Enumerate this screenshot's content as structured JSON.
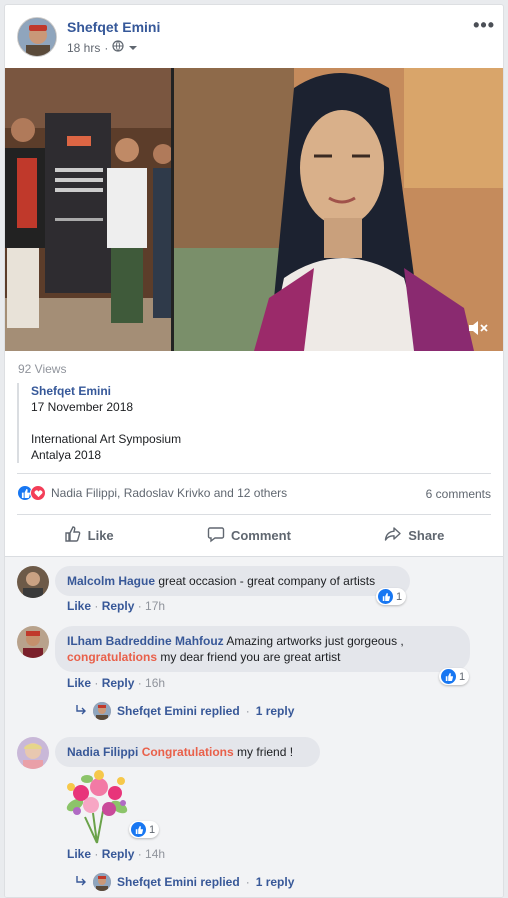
{
  "post": {
    "author": "Shefqet Emini",
    "time": "18 hrs",
    "privacy_icon": "globe-icon",
    "more_icon": "more-dots-icon",
    "views": "92 Views"
  },
  "quote": {
    "name": "Shefqet Emini",
    "date": "17 November 2018",
    "line1": "International Art Symposium",
    "line2": "Antalya 2018"
  },
  "reactions": {
    "summary": "Nadia Filippi, Radoslav Krivko and 12 others",
    "comments": "6 comments"
  },
  "actions": {
    "like": "Like",
    "comment": "Comment",
    "share": "Share"
  },
  "comments": [
    {
      "name": "Malcolm Hague",
      "text": "great occasion - great company of artists",
      "like": "Like",
      "reply": "Reply",
      "time": "17h",
      "reactions": "1"
    },
    {
      "name": "ILham Badreddine Mahfouz",
      "text_a": "Amazing artworks just gorgeous ,",
      "highlight": "congratulations",
      "text_b": "my dear friend you are great artist",
      "like": "Like",
      "reply": "Reply",
      "time": "16h",
      "reactions": "1",
      "replies_by": "Shefqet Emini replied",
      "replies_count": "1 reply"
    },
    {
      "name": "Nadia Filippi",
      "highlight": "Congratulations",
      "text": "my friend !",
      "like": "Like",
      "reply": "Reply",
      "time": "14h",
      "sticker_reactions": "1",
      "replies_by": "Shefqet Emini replied",
      "replies_count": "1 reply"
    }
  ],
  "colors": {
    "link": "#365899",
    "highlight": "#e9604a",
    "like_blue": "#1877f2",
    "love_red": "#f33e58"
  }
}
